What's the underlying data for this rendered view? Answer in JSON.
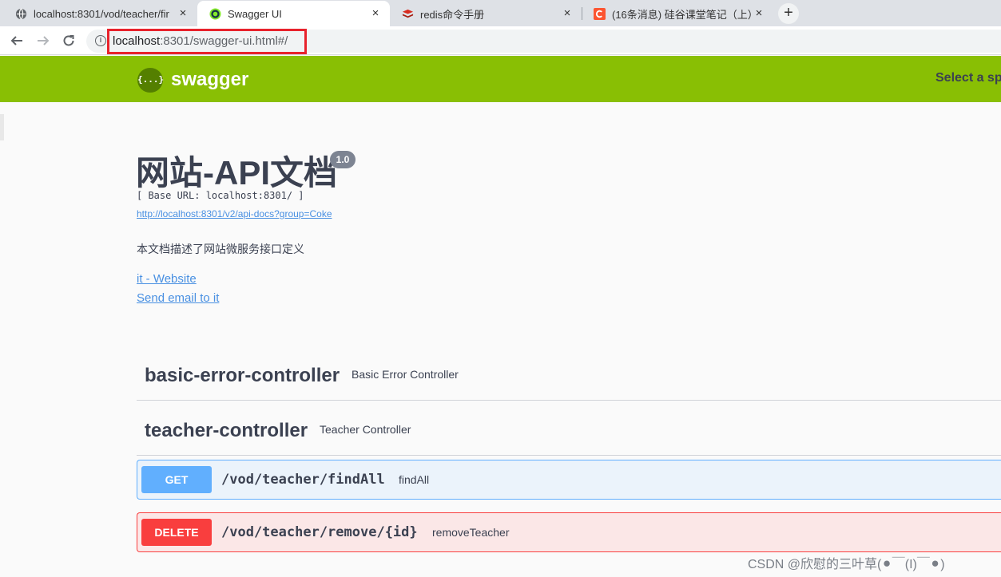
{
  "browser": {
    "tabs": [
      {
        "title": "localhost:8301/vod/teacher/fir",
        "icon": "globe-icon",
        "active": false
      },
      {
        "title": "Swagger UI",
        "icon": "swagger-favicon-icon",
        "active": true
      },
      {
        "title": "redis命令手册",
        "icon": "redis-favicon-icon",
        "active": false
      },
      {
        "title": "(16条消息) 硅谷课堂笔记（上）_",
        "icon": "csdn-favicon-icon",
        "active": false
      }
    ],
    "url_host": "localhost",
    "url_rest": ":8301/swagger-ui.html#/"
  },
  "swagger_header": {
    "logo_glyph": "{...}",
    "brand": "swagger",
    "select_label": "Select a sp"
  },
  "info": {
    "title": "网站-API文档",
    "version": "1.0",
    "base_url": "[ Base URL: localhost:8301/ ]",
    "docs_link": "http://localhost:8301/v2/api-docs?group=Coke",
    "description": "本文档描述了网站微服务接口定义",
    "contact_website": "it - Website",
    "contact_email": "Send email to it"
  },
  "tags": [
    {
      "name": "basic-error-controller",
      "description": "Basic Error Controller"
    },
    {
      "name": "teacher-controller",
      "description": "Teacher Controller"
    }
  ],
  "operations": [
    {
      "method": "GET",
      "path": "/vod/teacher/findAll",
      "summary": "findAll",
      "color": "#61affe"
    },
    {
      "method": "DELETE",
      "path": "/vod/teacher/remove/{id}",
      "summary": "removeTeacher",
      "color": "#f93e3e"
    }
  ],
  "watermark": "CSDN @欣慰的三叶草(⚫￣(I)￣⚫)",
  "colors": {
    "swagger_green": "#89bf04",
    "get_blue": "#61affe",
    "delete_red": "#f93e3e",
    "highlight_red": "#e8222c"
  }
}
